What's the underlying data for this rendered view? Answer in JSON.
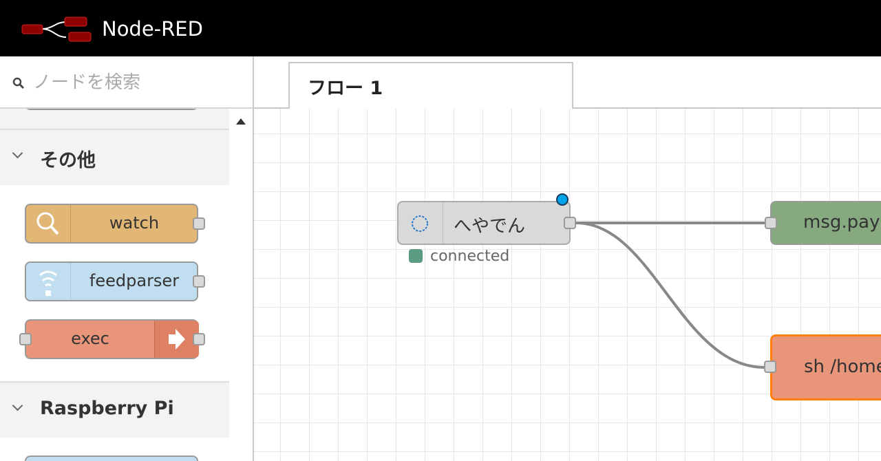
{
  "header": {
    "app_title": "Node-RED",
    "logo_icon": "node-red-logo-icon"
  },
  "palette": {
    "search": {
      "placeholder": "ノードを検索"
    },
    "categories": [
      {
        "label": "その他",
        "nodes": [
          {
            "label": "watch",
            "icon": "magnifier-icon",
            "color": "#e2b775"
          },
          {
            "label": "feedparser",
            "icon": "rss-feed-icon",
            "color": "#c0def0"
          },
          {
            "label": "exec",
            "icon": "arrow-right-icon",
            "color": "#e8957a"
          }
        ]
      },
      {
        "label": "Raspberry Pi",
        "nodes": []
      }
    ]
  },
  "workspace": {
    "tabs": [
      {
        "label": "フロー 1"
      }
    ],
    "nodes": [
      {
        "label": "へやでん",
        "status": "connected",
        "color": "#d9d9d9"
      },
      {
        "label": "msg.pay",
        "color": "#87a980"
      },
      {
        "label": "sh /home",
        "color": "#e8957a"
      }
    ]
  }
}
